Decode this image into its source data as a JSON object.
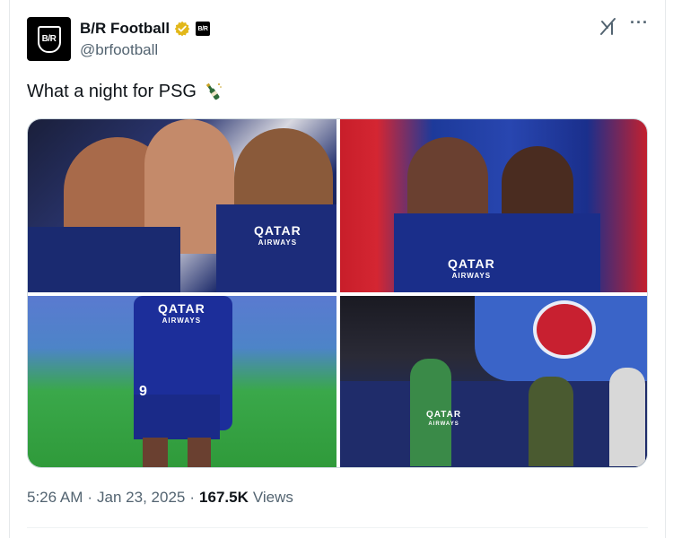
{
  "author": {
    "display_name": "B/R Football",
    "handle": "@brfootball",
    "avatar_text": "B/R",
    "affiliate_badge_text": "B/R"
  },
  "tweet": {
    "text": "What a night for PSG",
    "emoji": "champagne-bottle"
  },
  "media": {
    "photos": [
      {
        "shirt_sponsor": "QATAR",
        "shirt_sponsor_sub": "AIRWAYS"
      },
      {
        "shirt_sponsor": "QATAR",
        "shirt_sponsor_sub": "AIRWAYS"
      },
      {
        "shirt_sponsor": "QATAR",
        "shirt_sponsor_sub": "AIRWAYS",
        "shirt_number": "9"
      },
      {
        "shirt_sponsor": "QATAR",
        "shirt_sponsor_sub": "AIRWAYS"
      }
    ]
  },
  "meta": {
    "time": "5:26 AM",
    "date": "Jan 23, 2025",
    "separator": "·",
    "views_count": "167.5K",
    "views_label": "Views"
  },
  "colors": {
    "text_primary": "#0f1419",
    "text_secondary": "#536471",
    "verified_gold": "#e2b719",
    "border": "#cfd9de"
  },
  "icons": {
    "verified": "gold-verified-check-icon",
    "grok": "grok-icon",
    "more": "more-options-icon"
  }
}
